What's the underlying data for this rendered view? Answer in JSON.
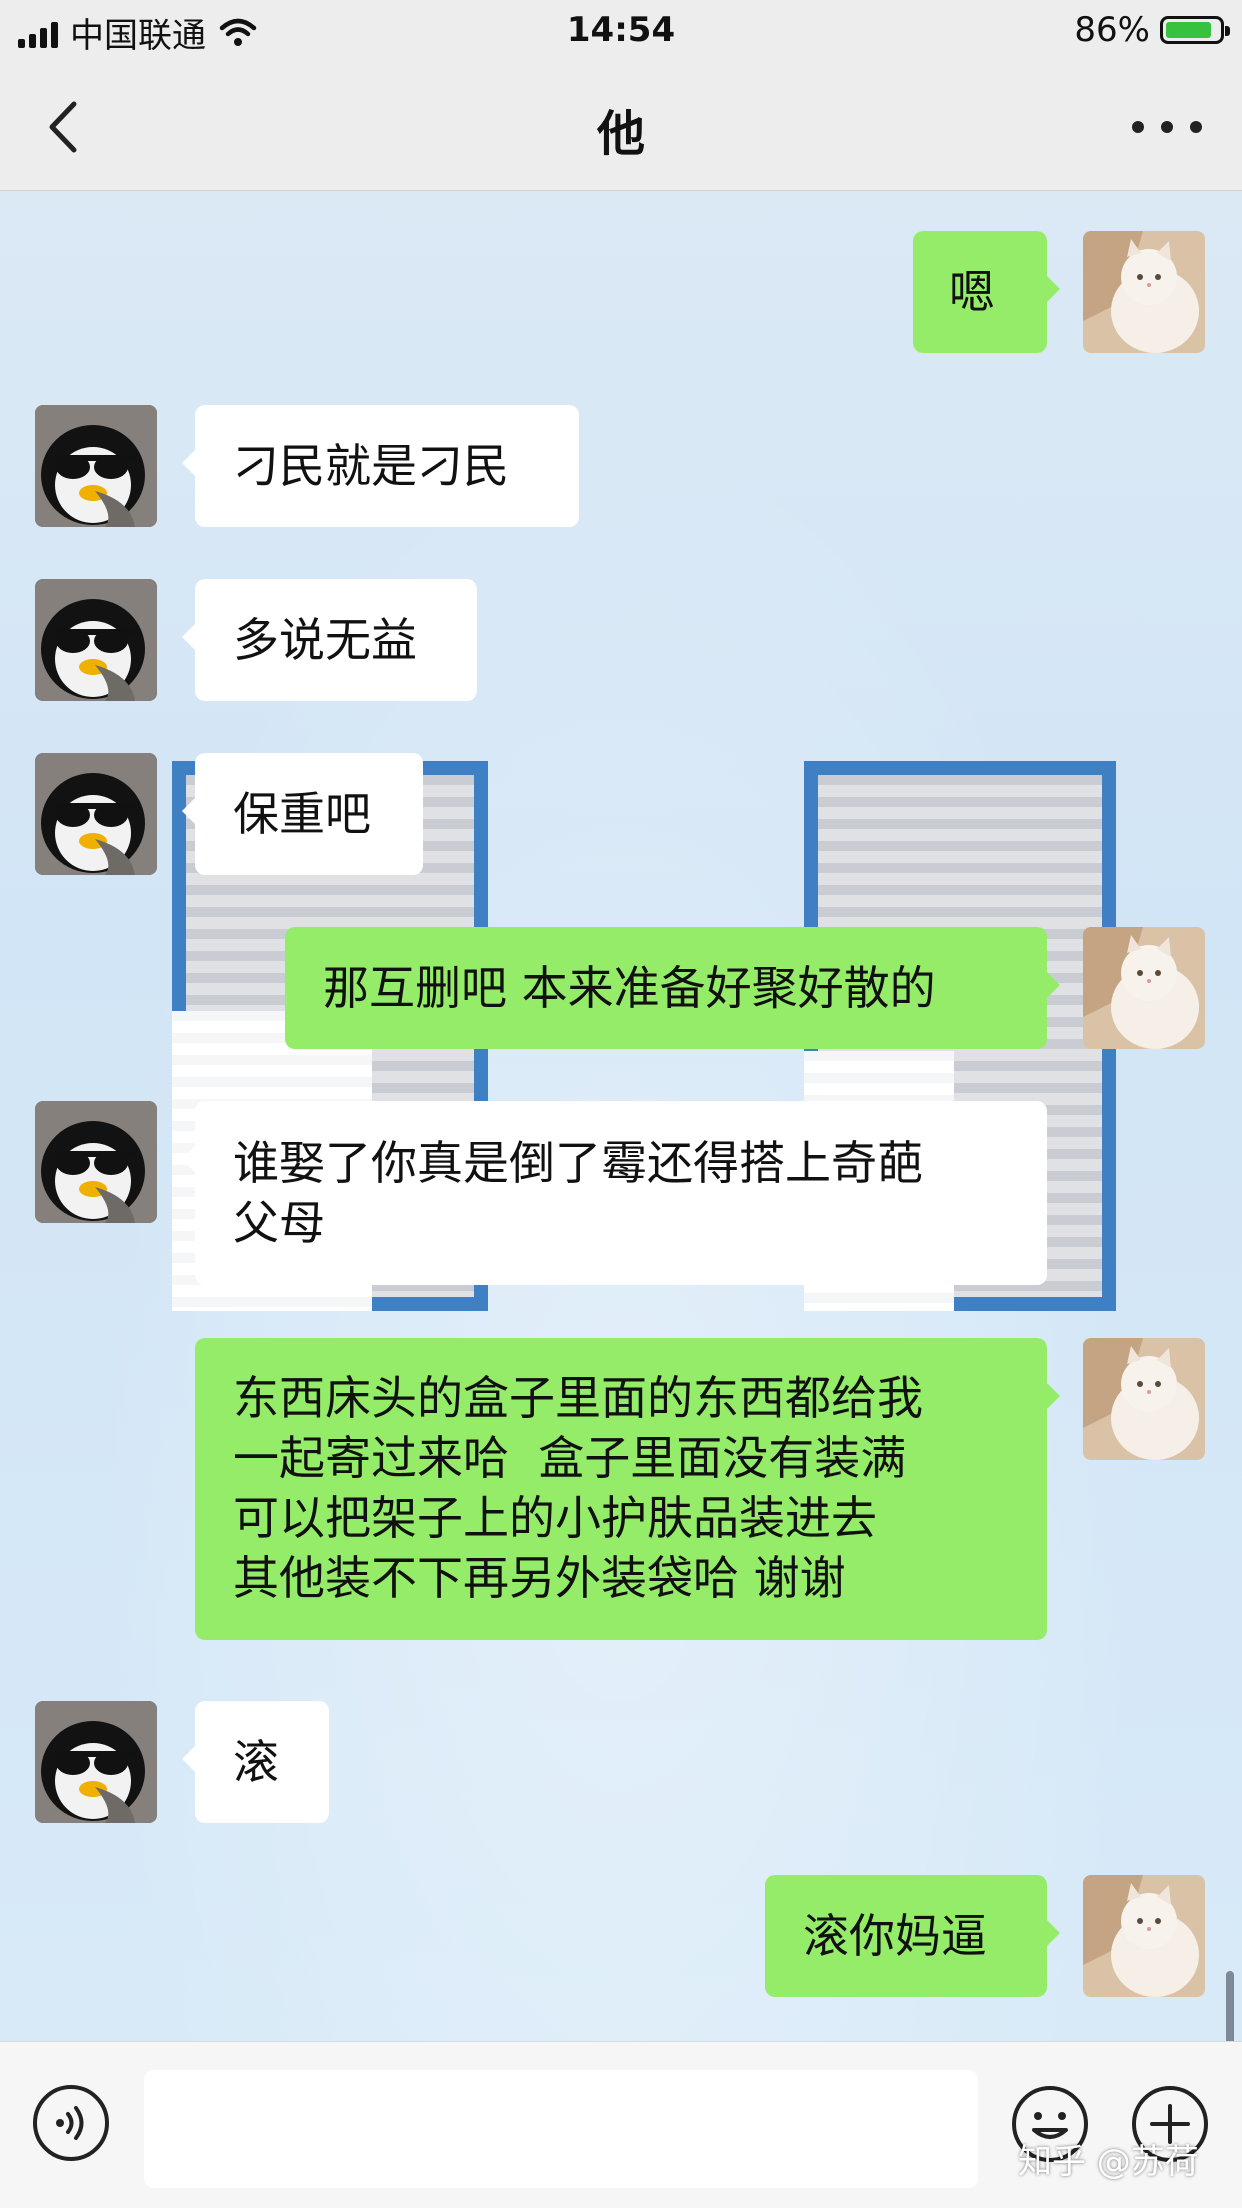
{
  "status_bar": {
    "carrier": "中国联通",
    "time": "14:54",
    "battery": "86%",
    "battery_level": 0.86
  },
  "nav": {
    "title": "他",
    "back_icon": "chevron-left-icon",
    "more_icon": "more-dots-icon"
  },
  "messages": [
    {
      "side": "right",
      "text": "嗯"
    },
    {
      "side": "left",
      "text": "刁民就是刁民"
    },
    {
      "side": "left",
      "text": "多说无益"
    },
    {
      "side": "left",
      "text": "保重吧"
    },
    {
      "side": "right",
      "text": "那互删吧 本来准备好聚好散的"
    },
    {
      "side": "left",
      "text": "谁娶了你真是倒了霉还得搭上奇葩\n父母"
    },
    {
      "side": "right",
      "text": "东西床头的盒子里面的东西都给我\n一起寄过来哈  盒子里面没有装满\n可以把架子上的小护肤品装进去\n其他装不下再另外装袋哈 谢谢"
    },
    {
      "side": "left",
      "text": "滚"
    },
    {
      "side": "right",
      "text": "滚你妈逼"
    }
  ],
  "input_bar": {
    "value": "",
    "icons": [
      "voice-icon",
      "emoji-icon",
      "plus-icon"
    ]
  },
  "watermark": "知乎 @苏荷",
  "colors": {
    "outgoing_bubble": "#95ec69",
    "incoming_bubble": "#ffffff",
    "bar_background": "#ededed"
  }
}
